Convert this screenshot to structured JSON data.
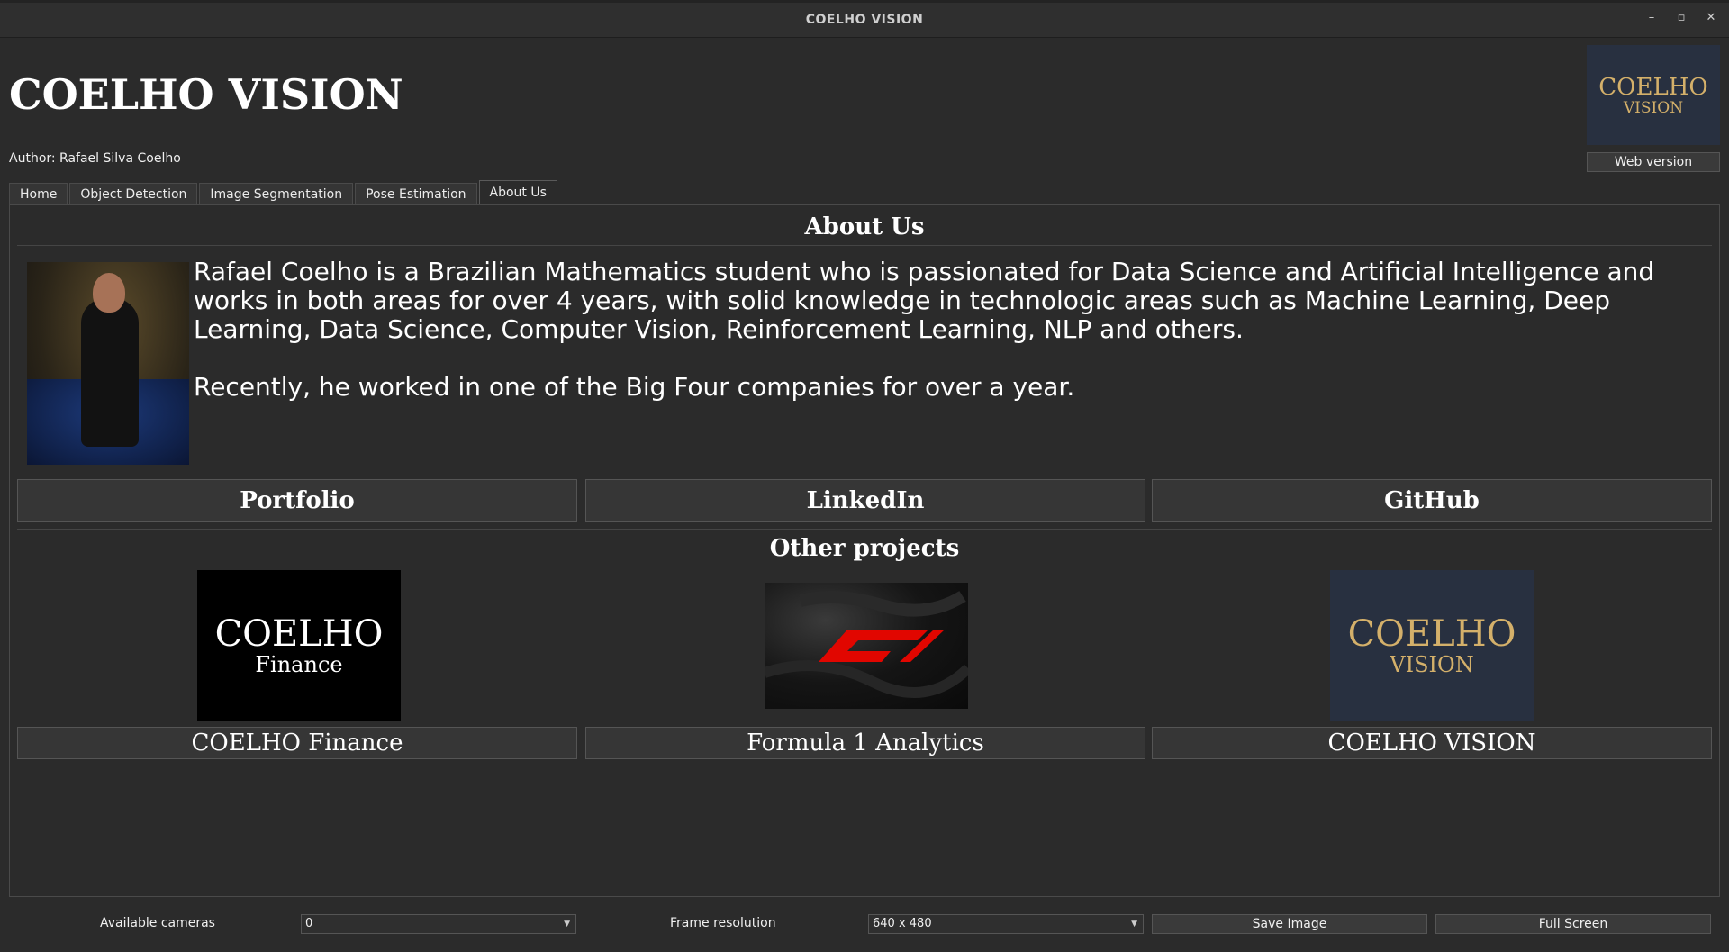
{
  "window": {
    "title": "COELHO VISION",
    "controls": {
      "minimize": "–",
      "restore": "▫",
      "close": "✕"
    }
  },
  "header": {
    "title": "COELHO VISION",
    "author": "Author: Rafael Silva Coelho",
    "logo": {
      "line1": "COELHO",
      "line2": "VISION"
    },
    "web_version_label": "Web version"
  },
  "tabs": [
    {
      "label": "Home",
      "active": false
    },
    {
      "label": "Object Detection",
      "active": false
    },
    {
      "label": "Image Segmentation",
      "active": false
    },
    {
      "label": "Pose Estimation",
      "active": false
    },
    {
      "label": "About Us",
      "active": true
    }
  ],
  "about": {
    "title": "About Us",
    "bio_paragraphs": [
      "Rafael Coelho is a Brazilian Mathematics student who is passionated for Data Science and Artificial Intelligence and works in both areas for over 4 years, with solid knowledge in technologic areas such as Machine Learning, Deep Learning, Data Science, Computer Vision, Reinforcement Learning, NLP and others.",
      "Recently, he worked in one of the Big Four companies for over a year."
    ],
    "links": [
      "Portfolio",
      "LinkedIn",
      "GitHub"
    ]
  },
  "projects": {
    "title": "Other projects",
    "finance_logo": {
      "line1": "COELHO",
      "line2": "Finance"
    },
    "vision_logo": {
      "line1": "COELHO",
      "line2": "VISION"
    },
    "items": [
      "COELHO Finance",
      "Formula 1 Analytics",
      "COELHO VISION"
    ]
  },
  "bottom": {
    "cameras_label": "Available cameras",
    "camera_value": "0",
    "resolution_label": "Frame resolution",
    "resolution_value": "640 x 480",
    "save_label": "Save Image",
    "fullscreen_label": "Full Screen"
  },
  "colors": {
    "background": "#2b2b2b",
    "logo_gold": "#d4b06a",
    "logo_navy": "#283040",
    "f1_red": "#e10600"
  }
}
